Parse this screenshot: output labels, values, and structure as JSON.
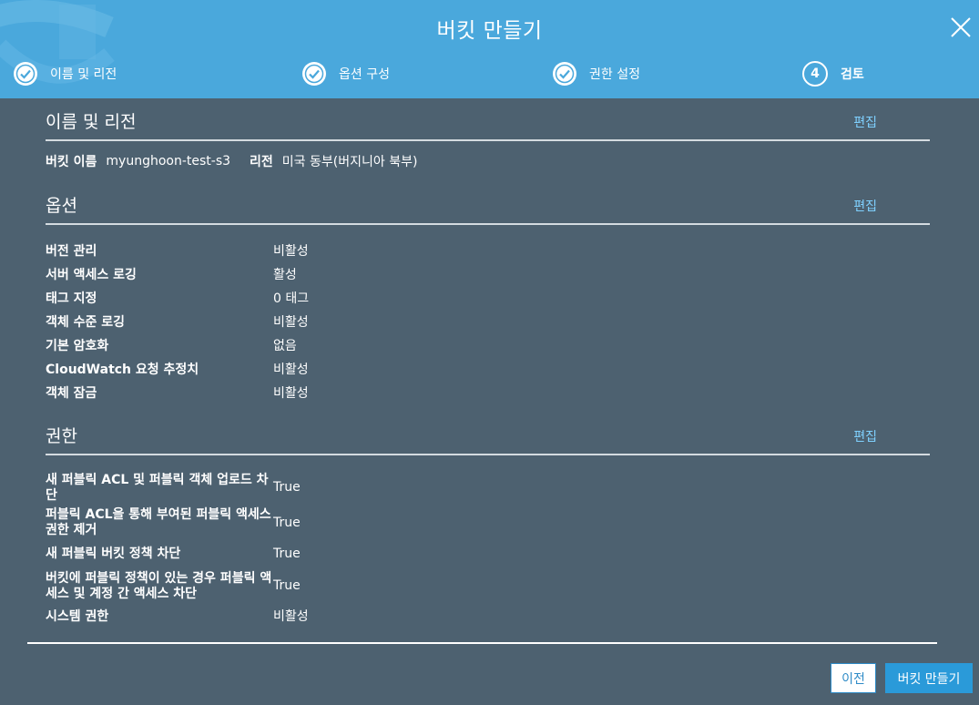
{
  "dialog": {
    "title": "버킷 만들기"
  },
  "steps": [
    {
      "label": "이름 및 리전",
      "state": "done",
      "icon": "check-icon"
    },
    {
      "label": "옵션 구성",
      "state": "done",
      "icon": "check-icon"
    },
    {
      "label": "권한 설정",
      "state": "done",
      "icon": "check-icon"
    },
    {
      "label": "검토",
      "state": "active",
      "number": "4"
    }
  ],
  "section_name": {
    "title": "이름 및 리전",
    "edit": "편집",
    "bucket_label": "버킷 이름",
    "bucket_value": "myunghoon-test-s3",
    "region_label": "리전",
    "region_value": "미국 동부(버지니아 북부)"
  },
  "section_options": {
    "title": "옵션",
    "edit": "편집",
    "rows": [
      {
        "key": "버전 관리",
        "value": "비활성"
      },
      {
        "key": "서버 액세스 로깅",
        "value": "활성"
      },
      {
        "key": "태그 지정",
        "value": "0 태그"
      },
      {
        "key": "객체 수준 로깅",
        "value": "비활성"
      },
      {
        "key": "기본 암호화",
        "value": "없음"
      },
      {
        "key": "CloudWatch 요청 추정치",
        "value": "비활성"
      },
      {
        "key": "객체 잠금",
        "value": "비활성"
      }
    ]
  },
  "section_permissions": {
    "title": "권한",
    "edit": "편집",
    "rows": [
      {
        "key": "새 퍼블릭 ACL 및 퍼블릭 객체 업로드 차단",
        "value": "True"
      },
      {
        "key": "퍼블릭 ACL을 통해 부여된 퍼블릭 액세스 권한 제거",
        "value": "True"
      },
      {
        "key": "새 퍼블릭 버킷 정책 차단",
        "value": "True"
      },
      {
        "key": "버킷에 퍼블릭 정책이 있는 경우 퍼블릭 액세스 및 계정 간 액세스 차단",
        "value": "True"
      },
      {
        "key": "시스템 권한",
        "value": "비활성"
      }
    ]
  },
  "footer": {
    "prev_label": "이전",
    "create_label": "버킷 만들기"
  },
  "colors": {
    "header_bg": "#4aa8dc",
    "body_bg": "#4d6170",
    "link": "#7fd1ff",
    "primary_button": "#2a9ad9"
  }
}
